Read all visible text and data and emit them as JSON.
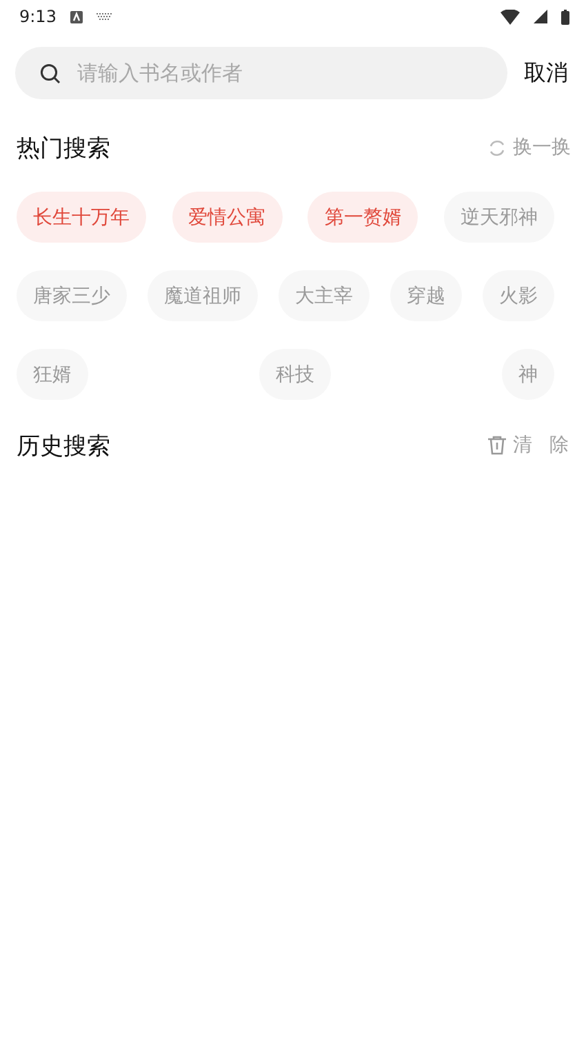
{
  "status_bar": {
    "time": "9:13"
  },
  "search": {
    "placeholder": "请输入书名或作者",
    "cancel": "取消"
  },
  "hot": {
    "title": "热门搜索",
    "refresh": "换一换",
    "tags": [
      {
        "label": "长生十万年",
        "hot": true
      },
      {
        "label": "爱情公寓",
        "hot": true
      },
      {
        "label": "第一赘婿",
        "hot": true
      },
      {
        "label": "逆天邪神",
        "hot": false
      },
      {
        "label": "唐家三少",
        "hot": false
      },
      {
        "label": "魔道祖师",
        "hot": false
      },
      {
        "label": "大主宰",
        "hot": false
      },
      {
        "label": "穿越",
        "hot": false
      },
      {
        "label": "火影",
        "hot": false
      },
      {
        "label": "狂婿",
        "hot": false
      },
      {
        "label": "科技",
        "hot": false
      },
      {
        "label": "神",
        "hot": false
      }
    ]
  },
  "history": {
    "title": "历史搜索",
    "clear": "清除"
  }
}
